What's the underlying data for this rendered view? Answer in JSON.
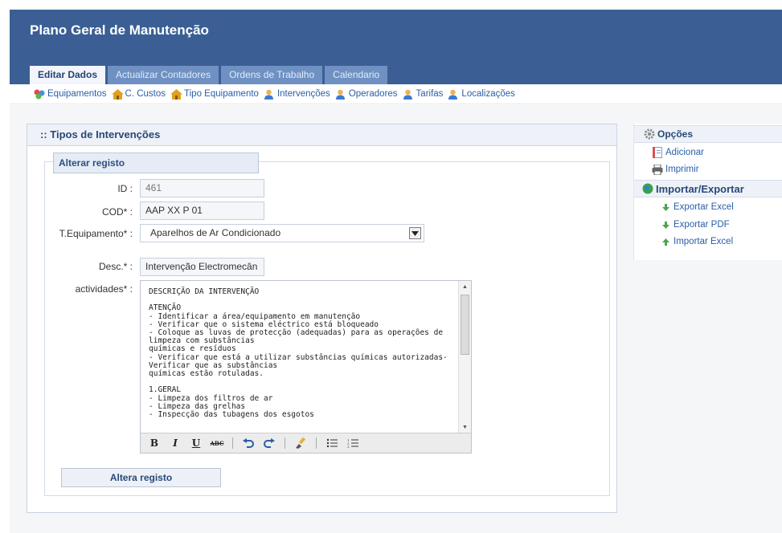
{
  "app": {
    "title": "Plano Geral de Manutenção"
  },
  "tabs": [
    {
      "label": "Editar Dados"
    },
    {
      "label": "Actualizar Contadores"
    },
    {
      "label": "Ordens de Trabalho"
    },
    {
      "label": "Calendario"
    }
  ],
  "toolbar": [
    {
      "label": "Equipamentos",
      "icon": "equipment-icon"
    },
    {
      "label": "C. Custos",
      "icon": "home-icon"
    },
    {
      "label": "Tipo Equipamento",
      "icon": "home-icon"
    },
    {
      "label": "Intervenções",
      "icon": "user-icon"
    },
    {
      "label": "Operadores",
      "icon": "user-icon"
    },
    {
      "label": "Tarifas",
      "icon": "user-icon"
    },
    {
      "label": "Localizações",
      "icon": "user-icon"
    }
  ],
  "panel": {
    "title": ":: Tipos de Intervenções",
    "legend": "Alterar registo"
  },
  "form": {
    "id_label": "ID :",
    "id_value": "461",
    "cod_label": "COD* :",
    "cod_value": "AAP XX P 01",
    "tipo_label": "T.Equipamento* :",
    "tipo_value": "Aparelhos de Ar Condicionado",
    "desc_label": "Desc.* :",
    "desc_value": "Intervenção Electromecân",
    "activ_label": "actividades* :",
    "activ_text": "DESCRIÇÃO DA INTERVENÇÃO\n\nATENÇÃO\n- Identificar a área/equipamento em manutenção\n- Verificar que o sistema eléctrico está bloqueado\n- Coloque as luvas de protecção (adequadas) para as operações de limpeza com substâncias\nquímicas e resíduos\n- Verificar que está a utilizar substâncias químicas autorizadas-Verificar que as substâncias\nquímicas estão rotuladas.\n\n1.GERAL\n- Limpeza dos filtros de ar\n- Limpeza das grelhas\n- Inspecção das tubagens dos esgotos",
    "submit_label": "Altera registo"
  },
  "editor_tools": [
    "B",
    "I",
    "U",
    "ABC"
  ],
  "sidebar": {
    "options_title": "Opções",
    "add_label": "Adicionar",
    "print_label": "Imprimir",
    "import_export_title": "Importar/Exportar",
    "export_excel": "Exportar Excel",
    "export_pdf": "Exportar PDF",
    "import_excel": "Importar Excel"
  }
}
